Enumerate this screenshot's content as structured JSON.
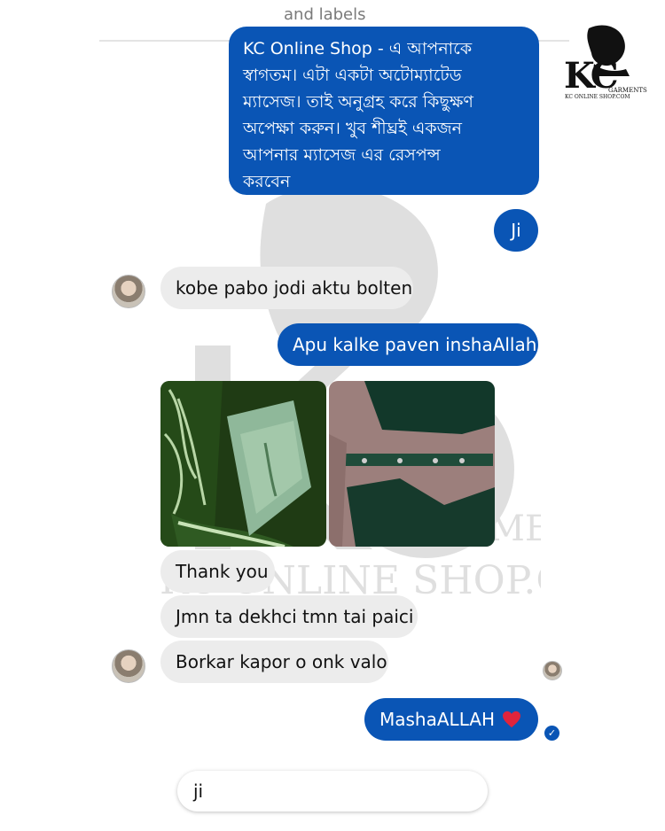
{
  "header": {
    "partial_label": "and labels"
  },
  "brand": {
    "logo_initials": "KC",
    "logo_tagline": "GARMENTS",
    "logo_site": "KC ONLINE SHOP.COM"
  },
  "watermark": {
    "line1": "GARMENTS",
    "line2": "KC ONLINE SHOP.COM"
  },
  "messages": [
    {
      "from": "shop",
      "text": "KC Online Shop - এ আপনাকে\nস্বাগতম। এটা একটা অটোম্যাটেড\nম্যাসেজ। তাই অনুগ্রহ করে কিছুক্ষণ\nঅপেক্ষা করুন। খুব শীঘ্রই একজন\nআপনার ম্যাসেজ এর রেসপন্স\nকরবেন"
    },
    {
      "from": "shop",
      "text": "Ji"
    },
    {
      "from": "customer",
      "text": "kobe pabo jodi aktu bolten"
    },
    {
      "from": "shop",
      "text": "Apu kalke paven inshaAllah"
    },
    {
      "from": "customer",
      "text": "Thank you"
    },
    {
      "from": "customer",
      "text": "Jmn ta dekhci tmn tai paici"
    },
    {
      "from": "customer",
      "text": "Borkar kapor o onk valo"
    },
    {
      "from": "shop",
      "text": "MashaALLAH"
    }
  ],
  "composer": {
    "value": "ji"
  },
  "icons": {
    "heart": "heart-icon",
    "seen": "check-circle-icon"
  },
  "colors": {
    "outgoing_bubble": "#0a55b5",
    "incoming_bubble": "#ececec",
    "heart": "#e0243c"
  }
}
